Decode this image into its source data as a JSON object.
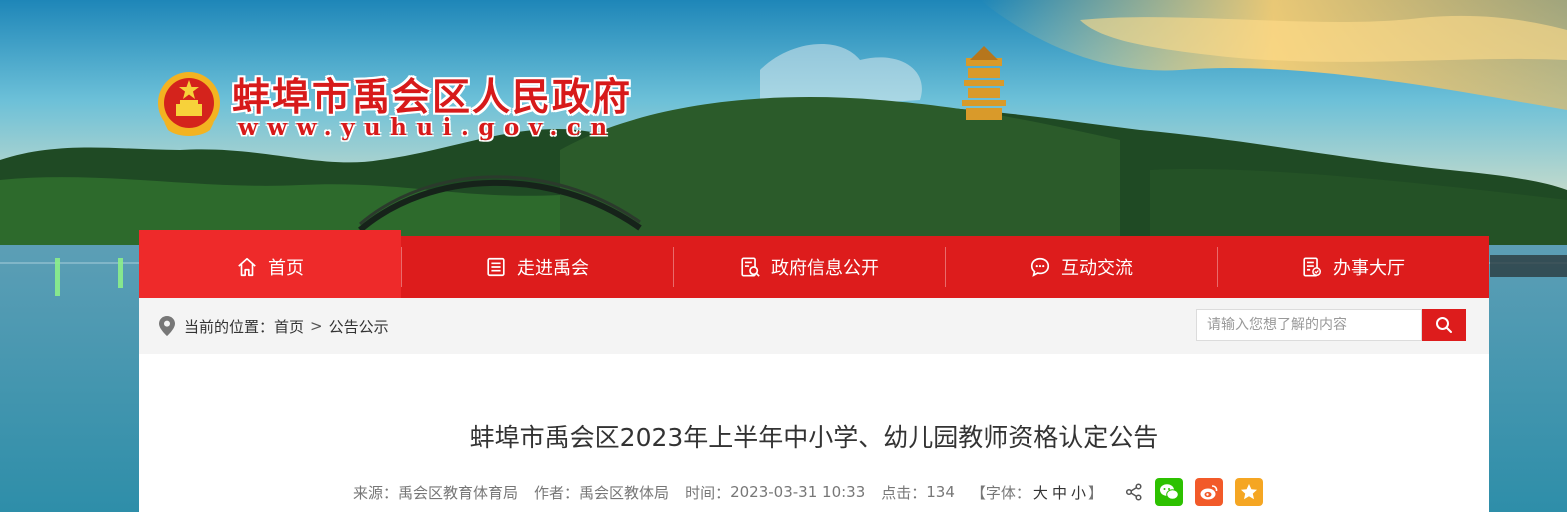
{
  "site": {
    "name": "蚌埠市禹会区人民政府",
    "domain": "www.yuhui.gov.cn"
  },
  "nav": [
    {
      "label": "首页",
      "icon": "home-icon",
      "active": true
    },
    {
      "label": "走进禹会",
      "icon": "list-icon"
    },
    {
      "label": "政府信息公开",
      "icon": "document-icon"
    },
    {
      "label": "互动交流",
      "icon": "chat-icon"
    },
    {
      "label": "办事大厅",
      "icon": "service-hall-icon"
    }
  ],
  "breadcrumb": {
    "prefix": "当前的位置：",
    "items": [
      "首页",
      "公告公示"
    ],
    "separator": ">"
  },
  "search": {
    "placeholder": "请输入您想了解的内容"
  },
  "article": {
    "title": "蚌埠市禹会区2023年上半年中小学、幼儿园教师资格认定公告",
    "source_label": "来源：",
    "source": "禹会区教育体育局",
    "author_label": "作者：",
    "author": "禹会区教体局",
    "time_label": "时间：",
    "time": "2023-03-31 10:33",
    "clicks_label": "点击：",
    "clicks": "134",
    "font_label": "【字体：",
    "font_sizes": [
      "大",
      "中",
      "小"
    ],
    "font_close": "】"
  },
  "colors": {
    "primary_red": "#dd1c1c",
    "active_red": "#ee2a2a",
    "wechat_green": "#2dc100",
    "weibo_orange": "#f25a29",
    "favorite_orange": "#f5a623"
  }
}
